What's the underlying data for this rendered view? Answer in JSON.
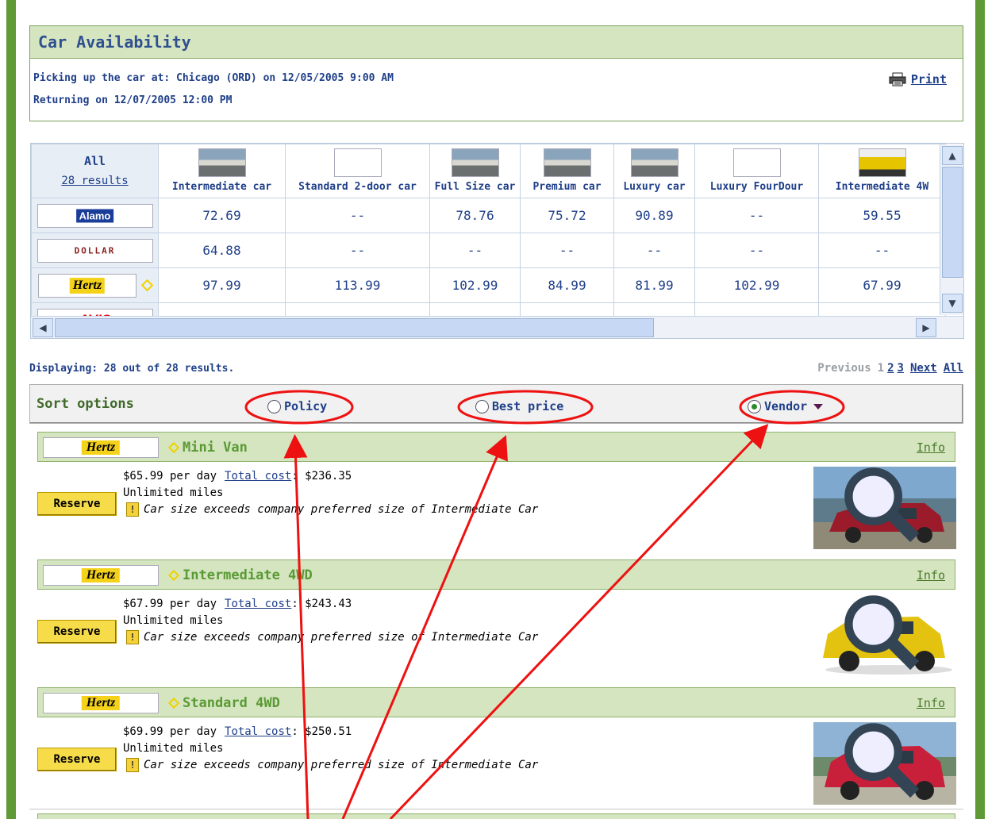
{
  "availability": {
    "title": "Car Availability",
    "pickup": "Picking up the car at: Chicago (ORD) on 12/05/2005 9:00 AM",
    "return": "Returning on 12/07/2005 12:00 PM",
    "print_label": "Print"
  },
  "grid": {
    "all_label": "All",
    "all_count": "28 results",
    "columns": [
      "Intermediate car",
      "Standard 2-door car",
      "Full Size car",
      "Premium car",
      "Luxury car",
      "Luxury FourDour",
      "Intermediate 4W"
    ],
    "vendors": [
      {
        "logo": "Alamo",
        "prices": [
          "72.69",
          "--",
          "78.76",
          "75.72",
          "90.89",
          "--",
          "59.55"
        ]
      },
      {
        "logo": "DOLLAR",
        "prices": [
          "64.88",
          "--",
          "--",
          "--",
          "--",
          "--",
          "--"
        ]
      },
      {
        "logo": "Hertz",
        "prices": [
          "97.99",
          "113.99",
          "102.99",
          "84.99",
          "81.99",
          "102.99",
          "67.99"
        ]
      },
      {
        "logo": "AVIS",
        "prices": [
          "",
          "",
          "",
          "",
          "",
          "",
          ""
        ]
      }
    ]
  },
  "results": {
    "displaying": "Displaying: 28 out of 28 results.",
    "pager": {
      "previous": "Previous",
      "pages": [
        "1",
        "2",
        "3"
      ],
      "next": "Next",
      "all": "All"
    }
  },
  "sort": {
    "label": "Sort options",
    "options": [
      {
        "label": "Policy",
        "selected": false
      },
      {
        "label": "Best price",
        "selected": false
      },
      {
        "label": "Vendor",
        "selected": true
      }
    ]
  },
  "cards": [
    {
      "vendor": "Hertz",
      "name": "Mini Van",
      "info": "Info",
      "reserve": "Reserve",
      "price_per_day": "$65.99 per day",
      "total_cost_label": "Total cost",
      "total_cost_value": ": $236.35",
      "miles": "Unlimited miles",
      "warning": "Car size exceeds company preferred size of Intermediate Car",
      "car_color": "#9b1b2a"
    },
    {
      "vendor": "Hertz",
      "name": "Intermediate 4WD",
      "info": "Info",
      "reserve": "Reserve",
      "price_per_day": "$67.99 per day",
      "total_cost_label": "Total cost",
      "total_cost_value": ": $243.43",
      "miles": "Unlimited miles",
      "warning": "Car size exceeds company preferred size of Intermediate Car",
      "car_color": "#e3c210"
    },
    {
      "vendor": "Hertz",
      "name": "Standard 4WD",
      "info": "Info",
      "reserve": "Reserve",
      "price_per_day": "$69.99 per day",
      "total_cost_label": "Total cost",
      "total_cost_value": ": $250.51",
      "miles": "Unlimited miles",
      "warning": "Car size exceeds company preferred size of Intermediate Car",
      "car_color": "#c8203a"
    }
  ],
  "colors": {
    "accent_green": "#5f9a36",
    "header_green": "#d4e5c0",
    "link_blue": "#1f3f88",
    "annotation_red": "#ee1111",
    "reserve_yellow": "#f7dc4a"
  },
  "icons": [
    "printer-icon",
    "diamond-icon",
    "warning-icon",
    "zoom-icon",
    "radio-icon",
    "caret-down-icon",
    "scroll-arrow-icon"
  ]
}
